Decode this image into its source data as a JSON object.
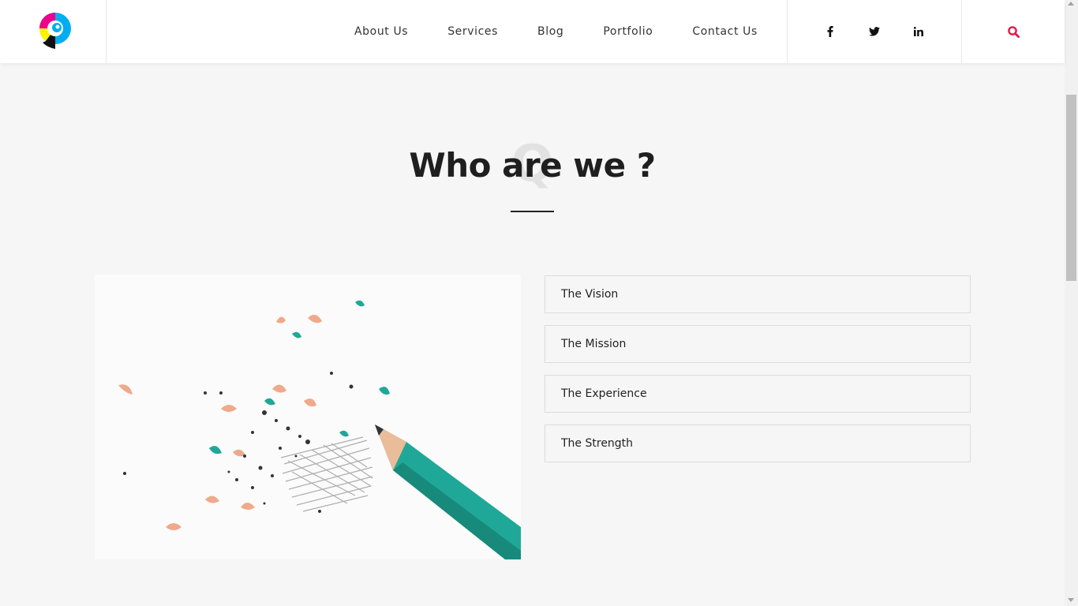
{
  "nav": {
    "items": [
      "About Us",
      "Services",
      "Blog",
      "Portfolio",
      "Contact Us"
    ]
  },
  "social": {
    "icons": [
      "facebook-icon",
      "twitter-icon",
      "linkedin-icon"
    ]
  },
  "search": {
    "icon": "search-icon",
    "color": "#e8184a"
  },
  "section": {
    "ghost_letter": "Q",
    "title": "Who are we ?"
  },
  "accordion": {
    "items": [
      "The Vision",
      "The Mission",
      "The Experience",
      "The Strength"
    ]
  },
  "colors": {
    "accent": "#e8184a",
    "pencil": "#1fa897",
    "background": "#f6f6f6"
  }
}
